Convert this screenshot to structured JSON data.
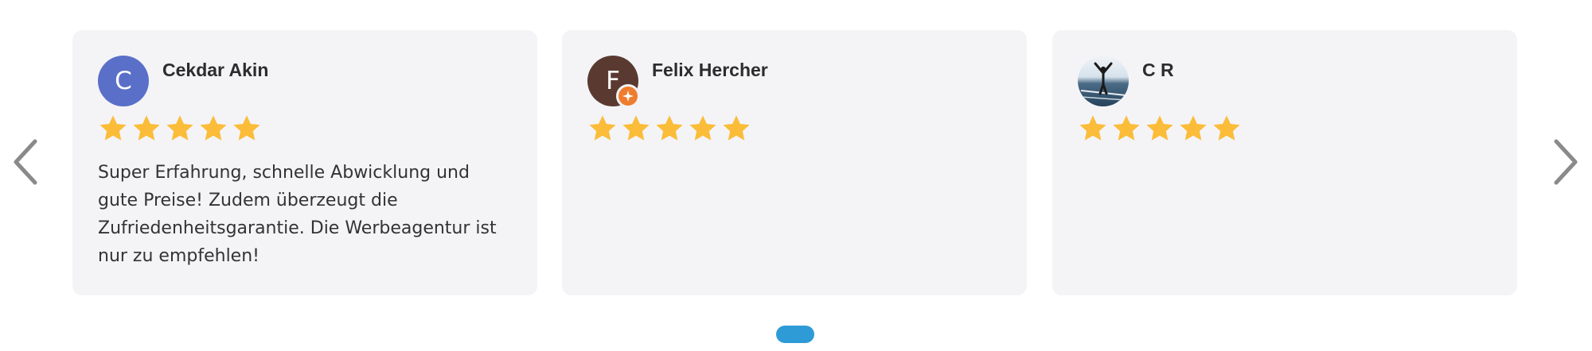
{
  "carousel": {
    "prev_icon": "chevron-left-icon",
    "next_icon": "chevron-right-icon",
    "pager_active_color": "#2e9bd6",
    "reviews": [
      {
        "name": "Cekdar Akin",
        "avatar_letter": "C",
        "avatar_color": "#5a6fc8",
        "rating": 5,
        "text": "Super Erfahrung, schnelle Abwicklung und gute Preise! Zudem überzeugt die Zufriedenheitsgarantie. Die Werbeagentur ist nur zu empfehlen!"
      },
      {
        "name": "Felix Hercher",
        "avatar_letter": "F",
        "avatar_color": "#5a3a30",
        "badge_icon": "local-guide-badge-icon",
        "rating": 5,
        "text": ""
      },
      {
        "name": "C R",
        "avatar_icon": "profile-photo",
        "rating": 5,
        "text": ""
      }
    ],
    "star_color": "#fbbd39"
  }
}
